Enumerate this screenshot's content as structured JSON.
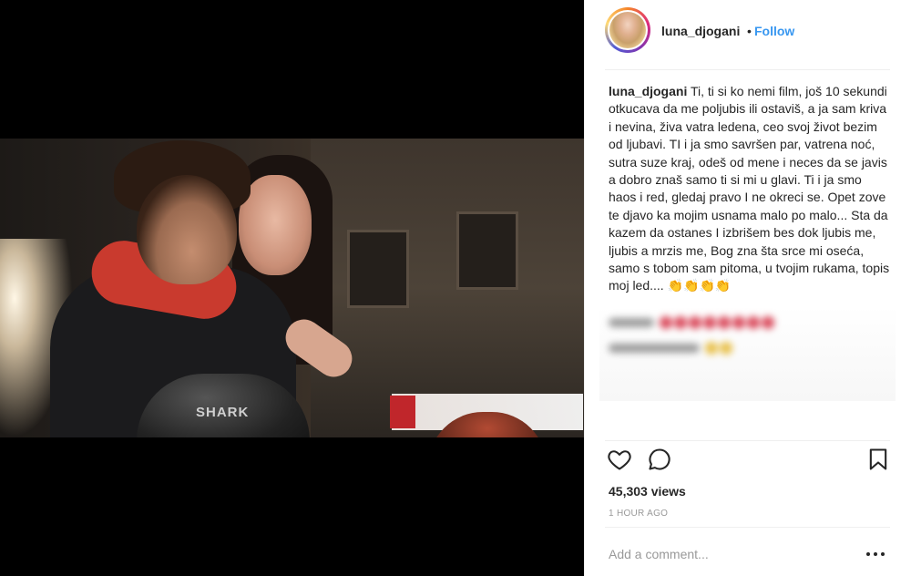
{
  "post": {
    "username": "luna_djogani",
    "separator": "•",
    "follow_label": "Follow",
    "caption_username": "luna_djogani",
    "caption_text": " Ti, ti si ko nemi film, još 10 sekundi otkucava da me poljubis ili ostaviš, a ja sam kriva i nevina, živa vatra ledena, ceo svoj život bezim od ljubavi. TI i ja smo savršen par, vatrena noć, sutra suze kraj, odeš od mene i neces da se javis a dobro znaš samo ti si mi u glavi. Ti i ja smo haos i red, gledaj pravo I ne okreci se. Opet zove te djavo ka mojim usnama malo po malo... Sta da kazem da ostanes I izbrišem bes dok ljubis me, ljubis a mrzis me, Bog zna šta srce mi oseća, samo s tobom sam pitoma, u tvojim rukama, topis moj led.... 👏👏👏👏",
    "views": "45,303 views",
    "time_ago": "1 HOUR AGO",
    "comment_placeholder": "Add a comment...",
    "video_overlay_text": "SHARK"
  },
  "icons": {
    "like": "heart-outline-icon",
    "comment": "speech-bubble-icon",
    "save": "bookmark-icon",
    "more": "ellipsis-icon"
  }
}
